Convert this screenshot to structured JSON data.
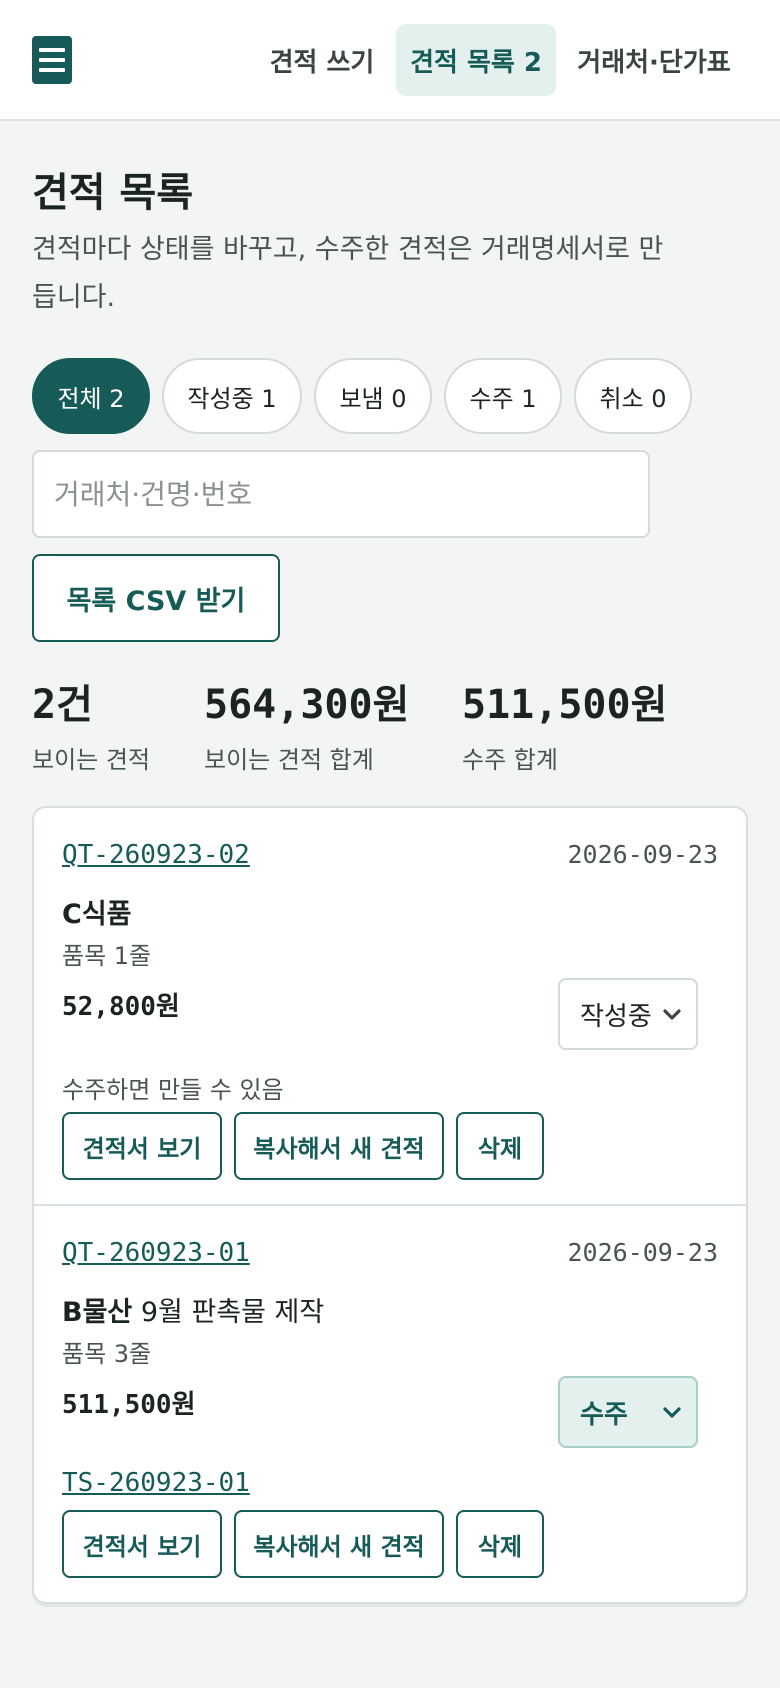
{
  "header": {
    "tabs": [
      {
        "label": "견적 쓰기",
        "active": false
      },
      {
        "label": "견적 목록 2",
        "active": true
      },
      {
        "label": "거래처·단가표",
        "active": false
      }
    ]
  },
  "page": {
    "title": "견적 목록",
    "description": "견적마다 상태를 바꾸고, 수주한 견적은 거래명세서로 만듭니다."
  },
  "filters": [
    {
      "label": "전체 2",
      "active": true
    },
    {
      "label": "작성중 1",
      "active": false
    },
    {
      "label": "보냄 0",
      "active": false
    },
    {
      "label": "수주 1",
      "active": false
    },
    {
      "label": "취소 0",
      "active": false
    }
  ],
  "search": {
    "placeholder": "거래처·건명·번호",
    "value": ""
  },
  "export": {
    "label": "목록 CSV 받기"
  },
  "summary": [
    {
      "value": "2건",
      "label": "보이는 견적"
    },
    {
      "value": "564,300원",
      "label": "보이는 견적 합계"
    },
    {
      "value": "511,500원",
      "label": "수주 합계"
    }
  ],
  "quotes": [
    {
      "number": "QT-260923-02",
      "date": "2026-09-23",
      "client": "C식품",
      "title": "",
      "lines": "품목 1줄",
      "amount": "52,800원",
      "status": "작성중",
      "note": "수주하면 만들 수 있음",
      "statement": "",
      "actions": {
        "view": "견적서 보기",
        "copy": "복사해서 새 견적",
        "delete": "삭제"
      }
    },
    {
      "number": "QT-260923-01",
      "date": "2026-09-23",
      "client": "B물산",
      "title": " 9월 판촉물 제작",
      "lines": "품목 3줄",
      "amount": "511,500원",
      "status": "수주",
      "note": "",
      "statement": "TS-260923-01",
      "actions": {
        "view": "견적서 보기",
        "copy": "복사해서 새 견적",
        "delete": "삭제"
      }
    }
  ],
  "colors": {
    "accent": "#165b58",
    "accent_soft": "#e3f0ed",
    "background": "#f3f5f4",
    "card": "#ffffff"
  },
  "icons": {
    "menu": "hamburger-menu-icon",
    "dropdown": "chevron-down-icon"
  }
}
